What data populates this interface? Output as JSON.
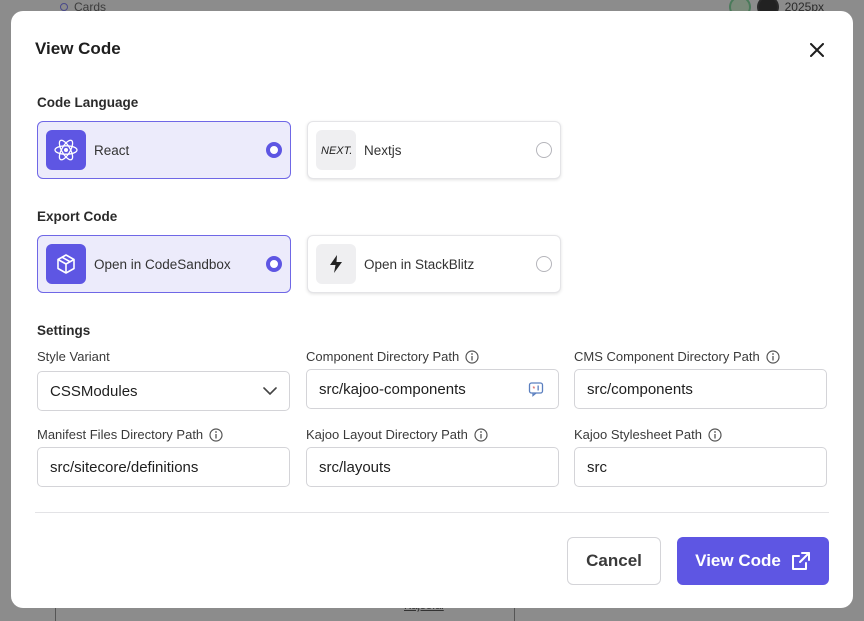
{
  "background": {
    "top_label": "Cards",
    "top_right_label": "2025px",
    "bottom_link": "Kajoo.ai"
  },
  "modal": {
    "title": "View Code",
    "close_icon": "close-icon"
  },
  "code_language": {
    "label": "Code Language",
    "options": [
      {
        "label": "React",
        "icon": "react-icon",
        "selected": true
      },
      {
        "label": "Nextjs",
        "icon": "nextjs-icon",
        "selected": false
      }
    ]
  },
  "export_code": {
    "label": "Export Code",
    "options": [
      {
        "label": "Open in CodeSandbox",
        "icon": "codesandbox-icon",
        "selected": true
      },
      {
        "label": "Open in StackBlitz",
        "icon": "stackblitz-icon",
        "selected": false
      }
    ]
  },
  "settings": {
    "label": "Settings",
    "style_variant": {
      "label": "Style Variant",
      "value": "CSSModules"
    },
    "component_dir": {
      "label": "Component Directory Path",
      "value": "src/kajoo-components"
    },
    "cms_component_dir": {
      "label": "CMS Component Directory Path",
      "value": "src/components"
    },
    "manifest_dir": {
      "label": "Manifest Files Directory Path",
      "value": "src/sitecore/definitions"
    },
    "layout_dir": {
      "label": "Kajoo Layout Directory Path",
      "value": "src/layouts"
    },
    "stylesheet_path": {
      "label": "Kajoo Stylesheet Path",
      "value": "src"
    }
  },
  "footer": {
    "cancel_label": "Cancel",
    "view_code_label": "View Code"
  },
  "colors": {
    "accent": "#5e56e3",
    "selected_bg": "#ecebfb"
  }
}
